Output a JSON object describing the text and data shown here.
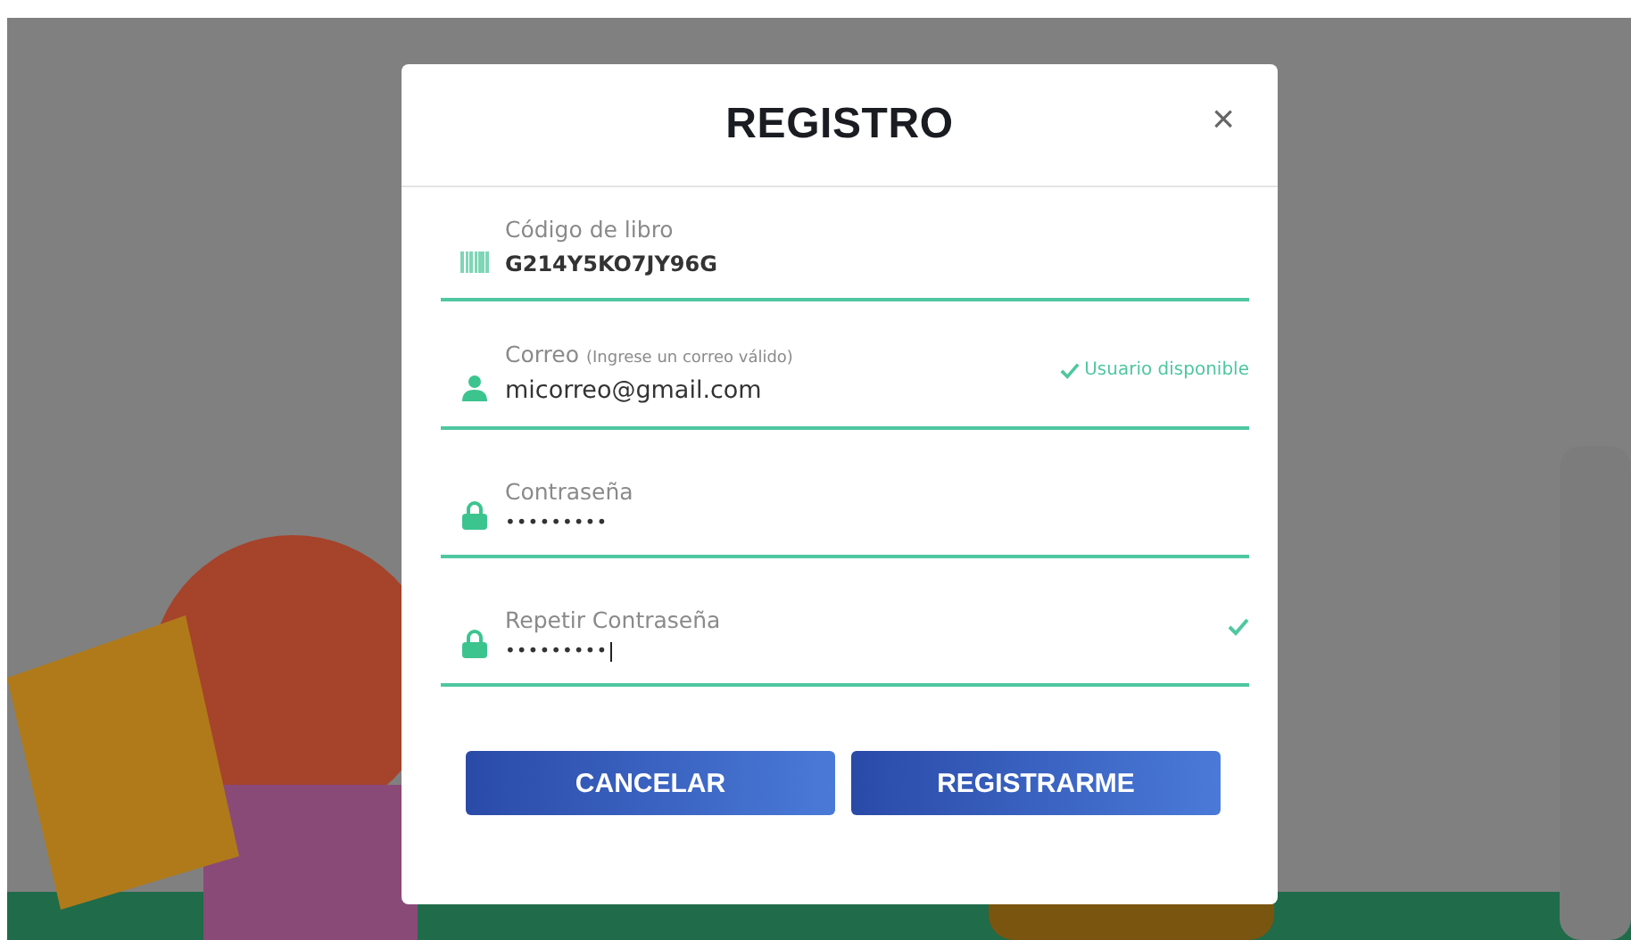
{
  "dialog": {
    "title": "REGISTRO",
    "close": "×"
  },
  "fields": [
    {
      "kind": "code",
      "label": "Código de libro",
      "value": "G214Y5KO7JY96G",
      "valid": false,
      "focused": false
    },
    {
      "kind": "email",
      "label": "Correo",
      "hint": "(Ingrese un correo válido)",
      "value": "micorreo@gmail.com",
      "valid": true,
      "status": "Usuario disponible",
      "focused": false
    },
    {
      "kind": "password",
      "label": "Contraseña",
      "value": "•••••••••",
      "valid": false,
      "focused": false
    },
    {
      "kind": "password",
      "label": "Repetir Contraseña",
      "value": "•••••••••",
      "valid": true,
      "focused": true
    }
  ],
  "buttons": [
    "CANCELAR",
    "REGISTRARME"
  ]
}
